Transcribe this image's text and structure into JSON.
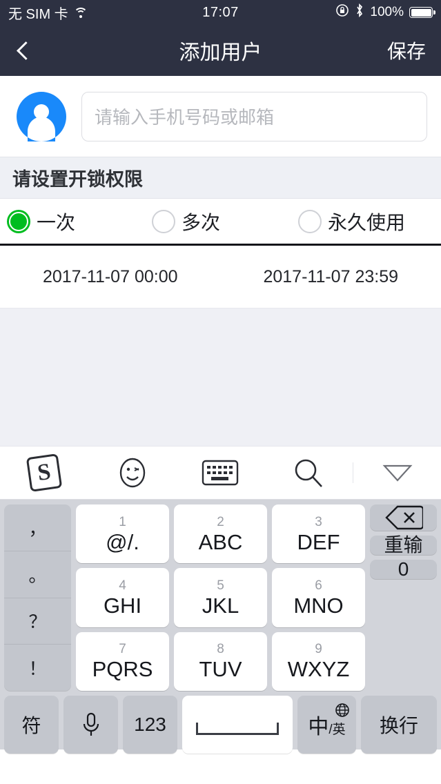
{
  "statusbar": {
    "carrier": "无 SIM 卡",
    "wifi_icon": "wifi-icon",
    "time": "17:07",
    "rotation_lock_icon": "rotation-lock-icon",
    "bluetooth_icon": "bluetooth-icon",
    "battery_percent": "100%",
    "battery_icon": "battery-full-icon"
  },
  "navbar": {
    "back_icon": "chevron-left-icon",
    "title": "添加用户",
    "save_label": "保存",
    "background": "#2d3142"
  },
  "user_row": {
    "avatar_icon": "user-avatar-icon",
    "avatar_color": "#1989fa",
    "input_value": "",
    "input_placeholder": "请输入手机号码或邮箱"
  },
  "section": {
    "title": "请设置开锁权限",
    "background": "#eef0f5"
  },
  "permission_options": [
    {
      "label": "一次",
      "selected": true
    },
    {
      "label": "多次",
      "selected": false
    },
    {
      "label": "永久使用",
      "selected": false
    }
  ],
  "selected_color": "#00bd1f",
  "date_range": {
    "start": "2017-11-07 00:00",
    "end": "2017-11-07 23:59"
  },
  "keyboard_toolbar": [
    {
      "icon": "sogou-logo-icon",
      "glyph": "S"
    },
    {
      "icon": "emoji-face-icon",
      "glyph": ""
    },
    {
      "icon": "keyboard-icon",
      "glyph": ""
    },
    {
      "icon": "search-icon",
      "glyph": ""
    },
    {
      "icon": "collapse-keyboard-icon",
      "glyph": ""
    }
  ],
  "keyboard": {
    "punctuation": [
      "，",
      "。",
      "？",
      "！"
    ],
    "keys": [
      {
        "num": "1",
        "letters": "@/."
      },
      {
        "num": "2",
        "letters": "ABC"
      },
      {
        "num": "3",
        "letters": "DEF"
      },
      {
        "num": "4",
        "letters": "GHI"
      },
      {
        "num": "5",
        "letters": "JKL"
      },
      {
        "num": "6",
        "letters": "MNO"
      },
      {
        "num": "7",
        "letters": "PQRS"
      },
      {
        "num": "8",
        "letters": "TUV"
      },
      {
        "num": "9",
        "letters": "WXYZ"
      }
    ],
    "backspace_icon": "backspace-icon",
    "redo_label": "重输",
    "zero_label": "0",
    "bottom": {
      "symbol_label": "符",
      "mic_icon": "microphone-icon",
      "numeric_label": "123",
      "space_label": "",
      "lang_zh": "中",
      "lang_en": "/英",
      "globe_icon": "globe-icon",
      "enter_label": "换行"
    }
  }
}
